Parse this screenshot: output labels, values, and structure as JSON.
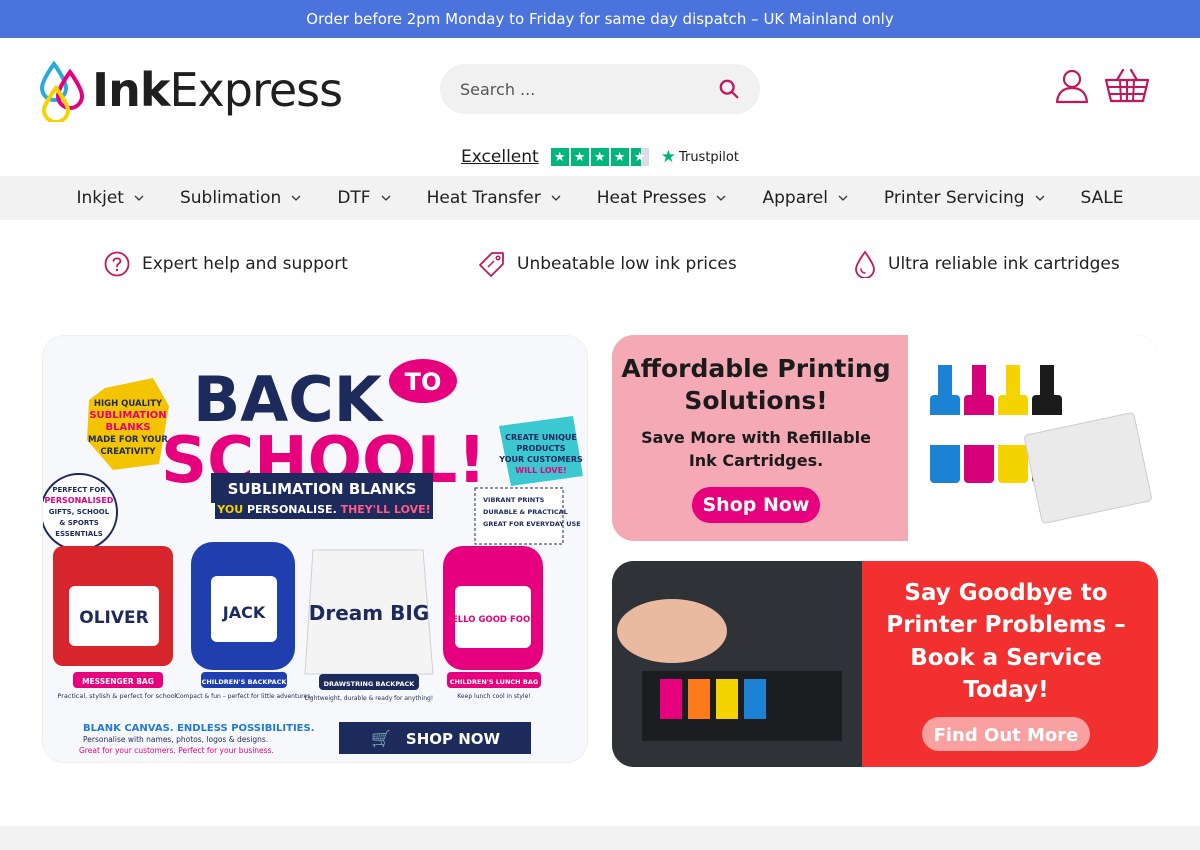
{
  "announcement": "Order before 2pm Monday to Friday for same day dispatch – UK Mainland only",
  "logo": {
    "word1": "Ink",
    "word2": "Express"
  },
  "search": {
    "placeholder": "Search ..."
  },
  "trustpilot": {
    "rating_label": "Excellent",
    "brand": "Trustpilot",
    "stars": 4.5
  },
  "nav": [
    "Inkjet",
    "Sublimation",
    "DTF",
    "Heat Transfer",
    "Heat Presses",
    "Apparel",
    "Printer Servicing",
    "SALE"
  ],
  "nav_has_dropdown": [
    true,
    true,
    true,
    true,
    true,
    true,
    true,
    false
  ],
  "usps": [
    {
      "icon": "question-icon",
      "text": "Expert help and support"
    },
    {
      "icon": "price-tag-icon",
      "text": "Unbeatable low ink prices"
    },
    {
      "icon": "ink-drop-icon",
      "text": "Ultra reliable ink cartridges"
    }
  ],
  "banners": {
    "school": {
      "title1": "BACK",
      "title_to": "TO",
      "title2": "SCHOOL!",
      "ribbon1": "SUBLIMATION BLANKS",
      "ribbon2a": "YOU",
      "ribbon2b": " PERSONALISE. ",
      "ribbon2c": "THEY'LL LOVE!",
      "badge_left": [
        "HIGH QUALITY",
        "SUBLIMATION",
        "BLANKS",
        "MADE FOR YOUR",
        "CREATIVITY"
      ],
      "badge_right": [
        "CREATE UNIQUE",
        "PRODUCTS",
        "YOUR CUSTOMERS",
        "WILL LOVE!"
      ],
      "circle": [
        "PERFECT FOR",
        "PERSONALISED",
        "GIFTS, SCHOOL",
        "& SPORTS",
        "ESSENTIALS"
      ],
      "checklist": [
        "VIBRANT PRINTS",
        "DURABLE & PRACTICAL",
        "GREAT FOR EVERYDAY USE"
      ],
      "products": [
        {
          "name": "MESSENGER BAG",
          "desc": "Practical, stylish & perfect for school.",
          "art": "OLIVER"
        },
        {
          "name": "CHILDREN'S BACKPACK",
          "desc": "Compact & fun – perfect for little adventures.",
          "art": "JACK"
        },
        {
          "name": "DRAWSTRING BACKPACK",
          "desc": "Lightweight, durable & ready for anything!",
          "art": "Dream BIG"
        },
        {
          "name": "CHILDREN'S LUNCH BAG",
          "desc": "Keep lunch cool in style!",
          "art": "HELLO GOOD FOOD!"
        }
      ],
      "footer1": "BLANK CANVAS. ENDLESS POSSIBILITIES.",
      "footer2": "Personalise with names, photos, logos & designs.",
      "footer3": "Great for your customers. Perfect for your business.",
      "cta": "SHOP NOW"
    },
    "refill": {
      "title1": "Affordable Printing",
      "title2": "Solutions!",
      "sub1": "Save More with Refillable",
      "sub2": "Ink Cartridges.",
      "cta": "Shop Now"
    },
    "service": {
      "line1": "Say Goodbye to",
      "line2": "Printer Problems –",
      "line3": "Book a Service",
      "line4": "Today!",
      "cta": "Find Out More"
    }
  },
  "colors": {
    "announcement_bg": "#4a73db",
    "accent": "#c2185b",
    "trustpilot_green": "#00b67a",
    "nav_bg": "#f2f2f2"
  }
}
